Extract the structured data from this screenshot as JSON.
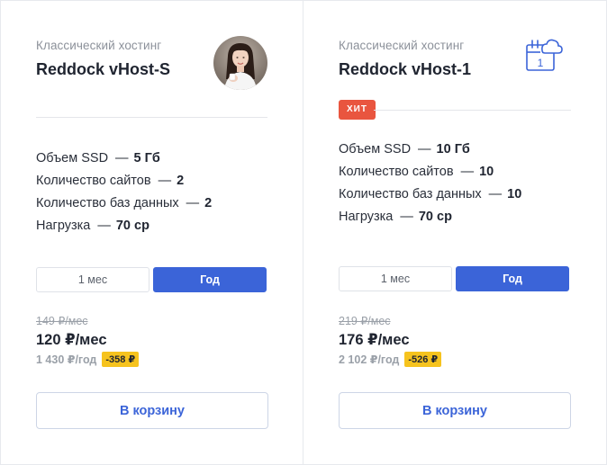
{
  "colors": {
    "accent": "#3b64d8",
    "hit_badge": "#e9553f",
    "discount_badge": "#f6c31e",
    "muted_text": "#8c919a",
    "border": "#e7e9ee"
  },
  "cards": [
    {
      "category": "Классический хостинг",
      "name": "Reddock vHost-S",
      "image": "avatar-photo",
      "specs": [
        {
          "label": "Объем SSD",
          "value": "5 Гб"
        },
        {
          "label": "Количество сайтов",
          "value": "2"
        },
        {
          "label": "Количество баз данных",
          "value": "2"
        },
        {
          "label": "Нагрузка",
          "value": "70 cp"
        }
      ],
      "dash": "—",
      "period": {
        "month_label": "1 мес",
        "year_label": "Год",
        "selected": "year"
      },
      "price_old": "149 ₽/мес",
      "price_main": "120 ₽/мес",
      "price_year": "1 430 ₽/год",
      "discount": "-358 ₽",
      "cart_label": "В корзину"
    },
    {
      "category": "Классический хостинг",
      "name": "Reddock vHost-1",
      "icon": "calendar-cloud-icon",
      "icon_number": "1",
      "badge": "ХИТ",
      "specs": [
        {
          "label": "Объем SSD",
          "value": "10 Гб"
        },
        {
          "label": "Количество сайтов",
          "value": "10"
        },
        {
          "label": "Количество баз данных",
          "value": "10"
        },
        {
          "label": "Нагрузка",
          "value": "70 cp"
        }
      ],
      "dash": "—",
      "period": {
        "month_label": "1 мес",
        "year_label": "Год",
        "selected": "year"
      },
      "price_old": "219 ₽/мес",
      "price_main": "176 ₽/мес",
      "price_year": "2 102 ₽/год",
      "discount": "-526 ₽",
      "cart_label": "В корзину"
    }
  ]
}
